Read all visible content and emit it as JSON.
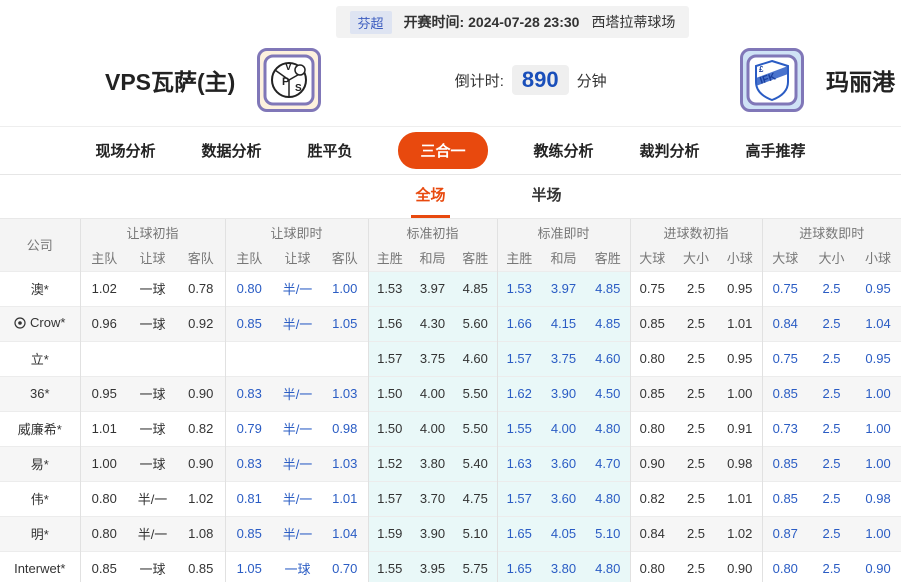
{
  "topbar": {
    "league": "芬超",
    "kickoff_label": "开赛时间:",
    "kickoff_time": "2024-07-28 23:30",
    "venue": "西塔拉蒂球场"
  },
  "match": {
    "home_team": "VPS瓦萨(主)",
    "away_team": "玛丽港",
    "countdown_label": "倒计时:",
    "countdown_value": "890",
    "countdown_unit": "分钟"
  },
  "nav": {
    "tabs": [
      "现场分析",
      "数据分析",
      "胜平负",
      "三合一",
      "教练分析",
      "裁判分析",
      "高手推荐"
    ],
    "active": "三合一"
  },
  "subtabs": {
    "tabs": [
      "全场",
      "半场"
    ],
    "active": "全场"
  },
  "table": {
    "company_header": "公司",
    "groups": [
      {
        "label": "让球初指",
        "cols": [
          "主队",
          "让球",
          "客队"
        ],
        "live": false,
        "highlight": false
      },
      {
        "label": "让球即时",
        "cols": [
          "主队",
          "让球",
          "客队"
        ],
        "live": true,
        "highlight": false
      },
      {
        "label": "标准初指",
        "cols": [
          "主胜",
          "和局",
          "客胜"
        ],
        "live": false,
        "highlight": true
      },
      {
        "label": "标准即时",
        "cols": [
          "主胜",
          "和局",
          "客胜"
        ],
        "live": true,
        "highlight": true
      },
      {
        "label": "进球数初指",
        "cols": [
          "大球",
          "大小",
          "小球"
        ],
        "live": false,
        "highlight": false
      },
      {
        "label": "进球数即时",
        "cols": [
          "大球",
          "大小",
          "小球"
        ],
        "live": true,
        "highlight": false
      }
    ],
    "rows": [
      {
        "company": "澳*",
        "icon": false,
        "cells": [
          "1.02",
          "一球",
          "0.78",
          "0.80",
          "半/一",
          "1.00",
          "1.53",
          "3.97",
          "4.85",
          "1.53",
          "3.97",
          "4.85",
          "0.75",
          "2.5",
          "0.95",
          "0.75",
          "2.5",
          "0.95"
        ]
      },
      {
        "company": "Crow*",
        "icon": true,
        "cells": [
          "0.96",
          "一球",
          "0.92",
          "0.85",
          "半/一",
          "1.05",
          "1.56",
          "4.30",
          "5.60",
          "1.66",
          "4.15",
          "4.85",
          "0.85",
          "2.5",
          "1.01",
          "0.84",
          "2.5",
          "1.04"
        ]
      },
      {
        "company": "立*",
        "icon": false,
        "cells": [
          "",
          "",
          "",
          "",
          "",
          "",
          "1.57",
          "3.75",
          "4.60",
          "1.57",
          "3.75",
          "4.60",
          "0.80",
          "2.5",
          "0.95",
          "0.75",
          "2.5",
          "0.95"
        ]
      },
      {
        "company": "36*",
        "icon": false,
        "cells": [
          "0.95",
          "一球",
          "0.90",
          "0.83",
          "半/一",
          "1.03",
          "1.50",
          "4.00",
          "5.50",
          "1.62",
          "3.90",
          "4.50",
          "0.85",
          "2.5",
          "1.00",
          "0.85",
          "2.5",
          "1.00"
        ]
      },
      {
        "company": "威廉希*",
        "icon": false,
        "cells": [
          "1.01",
          "一球",
          "0.82",
          "0.79",
          "半/一",
          "0.98",
          "1.50",
          "4.00",
          "5.50",
          "1.55",
          "4.00",
          "4.80",
          "0.80",
          "2.5",
          "0.91",
          "0.73",
          "2.5",
          "1.00"
        ]
      },
      {
        "company": "易*",
        "icon": false,
        "cells": [
          "1.00",
          "一球",
          "0.90",
          "0.83",
          "半/一",
          "1.03",
          "1.52",
          "3.80",
          "5.40",
          "1.63",
          "3.60",
          "4.70",
          "0.90",
          "2.5",
          "0.98",
          "0.85",
          "2.5",
          "1.00"
        ]
      },
      {
        "company": "伟*",
        "icon": false,
        "cells": [
          "0.80",
          "半/一",
          "1.02",
          "0.81",
          "半/一",
          "1.01",
          "1.57",
          "3.70",
          "4.75",
          "1.57",
          "3.60",
          "4.80",
          "0.82",
          "2.5",
          "1.01",
          "0.85",
          "2.5",
          "0.98"
        ]
      },
      {
        "company": "明*",
        "icon": false,
        "cells": [
          "0.80",
          "半/一",
          "1.08",
          "0.85",
          "半/一",
          "1.04",
          "1.59",
          "3.90",
          "5.10",
          "1.65",
          "4.05",
          "5.10",
          "0.84",
          "2.5",
          "1.02",
          "0.87",
          "2.5",
          "1.00"
        ]
      },
      {
        "company": "Interwet*",
        "icon": false,
        "cells": [
          "0.85",
          "一球",
          "0.85",
          "1.05",
          "一球",
          "0.70",
          "1.55",
          "3.95",
          "5.75",
          "1.65",
          "3.80",
          "4.80",
          "0.80",
          "2.5",
          "0.90",
          "0.80",
          "2.5",
          "0.90"
        ]
      }
    ]
  },
  "colors": {
    "accent": "#e8490e",
    "live_blue": "#2a5cc4",
    "highlight_bg": "#e9f8f8",
    "badge_blue": "#3b5bbf"
  }
}
